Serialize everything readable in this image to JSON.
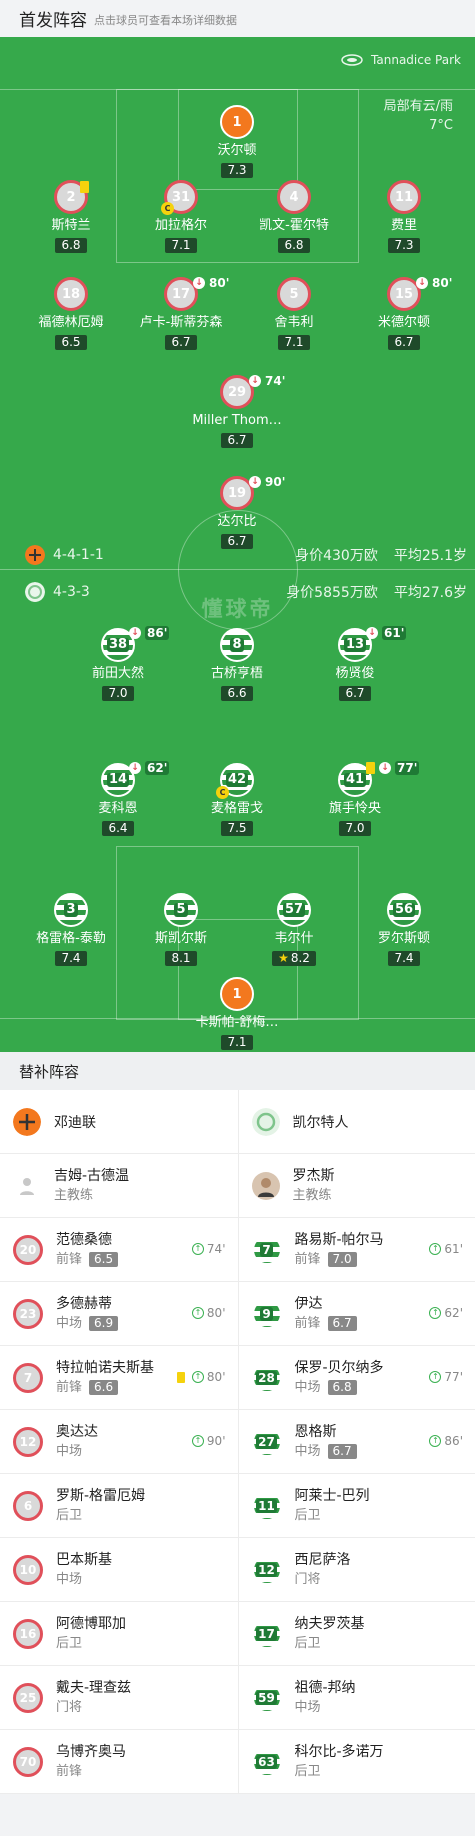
{
  "header": {
    "title": "首发阵容",
    "hint": "点击球员可查看本场详细数据"
  },
  "venue": "Tannadice Park",
  "weather": {
    "condition": "局部有云/雨",
    "temp": "7°C"
  },
  "watermark": "懂球帝",
  "home_team": {
    "formation": "4-4-1-1",
    "value_label": "身价430万欧",
    "age_label": "平均25.1岁"
  },
  "away_team": {
    "formation": "4-3-3",
    "value_label": "身价5855万欧",
    "age_label": "平均27.6岁"
  },
  "home_players": [
    {
      "num": "1",
      "name": "沃尔顿",
      "rating": "7.3",
      "kit": "gk"
    },
    {
      "num": "2",
      "name": "斯特兰",
      "rating": "6.8",
      "kit": "home",
      "yellow": true
    },
    {
      "num": "31",
      "name": "加拉格尔",
      "rating": "7.1",
      "kit": "home",
      "captain": "C"
    },
    {
      "num": "4",
      "name": "凯文-霍尔特",
      "rating": "6.8",
      "kit": "home"
    },
    {
      "num": "11",
      "name": "费里",
      "rating": "7.3",
      "kit": "home"
    },
    {
      "num": "18",
      "name": "福德林厄姆",
      "rating": "6.5",
      "kit": "home"
    },
    {
      "num": "17",
      "name": "卢卡-斯蒂芬森",
      "rating": "6.7",
      "kit": "home",
      "sub_min": "80'"
    },
    {
      "num": "5",
      "name": "舍韦利",
      "rating": "7.1",
      "kit": "home"
    },
    {
      "num": "15",
      "name": "米德尔顿",
      "rating": "6.7",
      "kit": "home",
      "sub_min": "80'"
    },
    {
      "num": "29",
      "name": "Miller Thom…",
      "rating": "6.7",
      "kit": "home",
      "sub_min": "74'"
    },
    {
      "num": "19",
      "name": "达尔比",
      "rating": "6.7",
      "kit": "home",
      "sub_min": "90'"
    }
  ],
  "away_players": [
    {
      "num": "38",
      "name": "前田大然",
      "rating": "7.0",
      "kit": "cel",
      "sub_min": "86'"
    },
    {
      "num": "8",
      "name": "古桥亨梧",
      "rating": "6.6",
      "kit": "cel"
    },
    {
      "num": "13",
      "name": "杨贤俊",
      "rating": "6.7",
      "kit": "cel",
      "sub_min": "61'"
    },
    {
      "num": "14",
      "name": "麦科恩",
      "rating": "6.4",
      "kit": "cel",
      "sub_min": "62'"
    },
    {
      "num": "42",
      "name": "麦格雷戈",
      "rating": "7.5",
      "kit": "cel",
      "captain": "C"
    },
    {
      "num": "41",
      "name": "旗手怜央",
      "rating": "7.0",
      "kit": "cel",
      "sub_min": "77'",
      "yellow": true
    },
    {
      "num": "3",
      "name": "格雷格-泰勒",
      "rating": "7.4",
      "kit": "cel"
    },
    {
      "num": "5",
      "name": "斯凯尔斯",
      "rating": "8.1",
      "kit": "cel"
    },
    {
      "num": "57",
      "name": "韦尔什",
      "rating": "8.2",
      "kit": "cel",
      "star": "★"
    },
    {
      "num": "56",
      "name": "罗尔斯顿",
      "rating": "7.4",
      "kit": "cel"
    },
    {
      "num": "1",
      "name": "卡斯帕-舒梅…",
      "rating": "7.1",
      "kit": "gk"
    }
  ],
  "subs_title": "替补阵容",
  "home_subs": {
    "team": "邓迪联",
    "coach": {
      "name": "吉姆-古德温",
      "role": "主教练"
    },
    "players": [
      {
        "num": "20",
        "name": "范德桑德",
        "pos": "前锋",
        "rating": "6.5",
        "on": "74'"
      },
      {
        "num": "23",
        "name": "多德赫蒂",
        "pos": "中场",
        "rating": "6.9",
        "on": "80'"
      },
      {
        "num": "7",
        "name": "特拉帕诺夫斯基",
        "pos": "前锋",
        "rating": "6.6",
        "on": "80'",
        "yellow": true
      },
      {
        "num": "12",
        "name": "奥达达",
        "pos": "中场",
        "rating": "",
        "on": "90'"
      },
      {
        "num": "6",
        "name": "罗斯-格雷厄姆",
        "pos": "后卫",
        "rating": "",
        "on": ""
      },
      {
        "num": "10",
        "name": "巴本斯基",
        "pos": "中场",
        "rating": "",
        "on": ""
      },
      {
        "num": "16",
        "name": "阿德博耶加",
        "pos": "后卫",
        "rating": "",
        "on": ""
      },
      {
        "num": "25",
        "name": "戴夫-理查兹",
        "pos": "门将",
        "rating": "",
        "on": ""
      },
      {
        "num": "70",
        "name": "乌博齐奥马",
        "pos": "前锋",
        "rating": "",
        "on": ""
      }
    ]
  },
  "away_subs": {
    "team": "凯尔特人",
    "coach": {
      "name": "罗杰斯",
      "role": "主教练"
    },
    "players": [
      {
        "num": "7",
        "name": "路易斯-帕尔马",
        "pos": "前锋",
        "rating": "7.0",
        "on": "61'"
      },
      {
        "num": "9",
        "name": "伊达",
        "pos": "前锋",
        "rating": "6.7",
        "on": "62'"
      },
      {
        "num": "28",
        "name": "保罗-贝尔纳多",
        "pos": "中场",
        "rating": "6.8",
        "on": "77'"
      },
      {
        "num": "27",
        "name": "恩格斯",
        "pos": "中场",
        "rating": "6.7",
        "on": "86'"
      },
      {
        "num": "11",
        "name": "阿莱士-巴列",
        "pos": "后卫",
        "rating": "",
        "on": ""
      },
      {
        "num": "12",
        "name": "西尼萨洛",
        "pos": "门将",
        "rating": "",
        "on": ""
      },
      {
        "num": "17",
        "name": "纳夫罗茨基",
        "pos": "后卫",
        "rating": "",
        "on": ""
      },
      {
        "num": "59",
        "name": "祖德-邦纳",
        "pos": "中场",
        "rating": "",
        "on": ""
      },
      {
        "num": "63",
        "name": "科尔比-多诺万",
        "pos": "后卫",
        "rating": "",
        "on": ""
      }
    ]
  },
  "colors": {
    "pitch": "#36a94b",
    "home": "#e0505a",
    "home_gk": "#f3781e",
    "away": "#2f9a44",
    "rating_bg": "#1f4a2a"
  }
}
